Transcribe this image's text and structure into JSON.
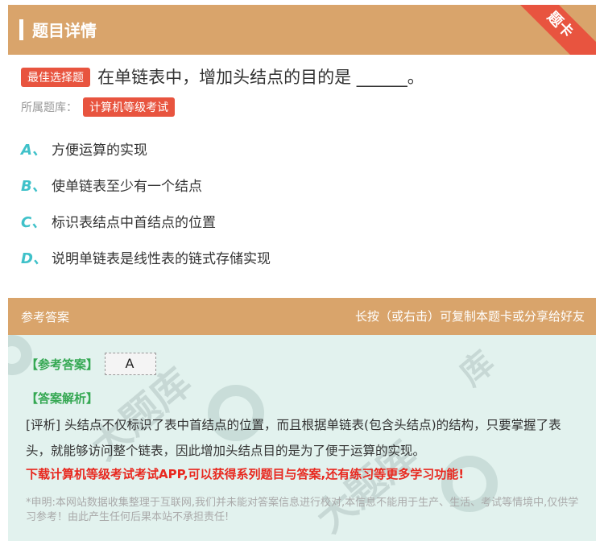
{
  "header": {
    "title": "题目详情",
    "ribbon": "题卡"
  },
  "question": {
    "type_tag": "最佳选择题",
    "text": "在单链表中，增加头结点的目的是 ______。",
    "bank_label": "所属题库：",
    "bank_name": "计算机等级考试"
  },
  "options": [
    {
      "letter": "A、",
      "text": "方便运算的实现"
    },
    {
      "letter": "B、",
      "text": "使单链表至少有一个结点"
    },
    {
      "letter": "C、",
      "text": "标识表结点中首结点的位置"
    },
    {
      "letter": "D、",
      "text": "说明单链表是线性表的链式存储实现"
    }
  ],
  "answer_bar": {
    "left": "参考答案",
    "right": "长按（或右击）可复制本题卡或分享给好友"
  },
  "answer": {
    "ref_label": "【参考答案】",
    "ref_value": "A",
    "analysis_label": "【答案解析】",
    "analysis_text": "[评析] 头结点不仅标识了表中首结点的位置，而且根据单链表(包含头结点)的结构，只要掌握了表头，就能够访问整个链表，因此增加头结点目的是为了便于运算的实现。",
    "promo": "下载计算机等级考试考试APP,可以获得系列题目与答案,还有练习等更多学习功能!",
    "disclaimer": "*申明:本网站数据收集整理于互联网,我们并未能对答案信息进行校对,本信息不能用于生产、生活、考试等情境中,仅供学习参考！由此产生任何后果本站不承担责任!"
  },
  "colors": {
    "accent": "#d9a46b",
    "tag_red": "#e8543f",
    "option_letter": "#3fc1c9",
    "answer_bg": "#e2f2ee",
    "green_label": "#35a853",
    "promo_red": "#e8281f"
  }
}
